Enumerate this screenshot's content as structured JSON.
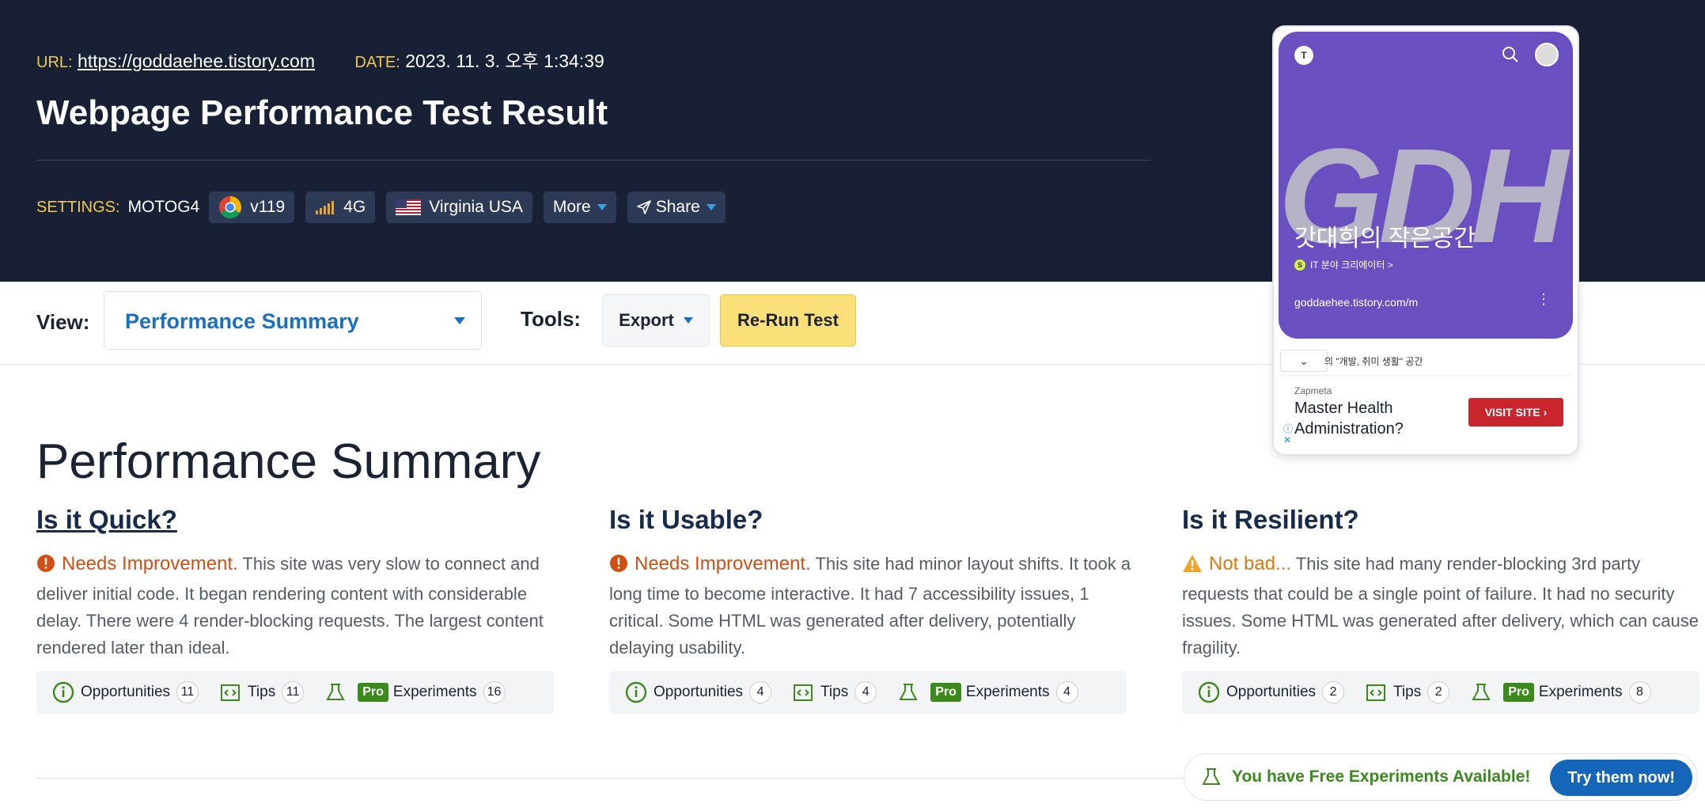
{
  "header": {
    "url_label": "URL:",
    "url": "https://goddaehee.tistory.com",
    "date_label": "DATE:",
    "date": "2023. 11. 3. 오후 1:34:39",
    "title": "Webpage Performance Test Result",
    "settings_label": "SETTINGS:",
    "device": "MOTOG4",
    "browser": "v119",
    "network": "4G",
    "location": "Virginia USA",
    "more": "More",
    "share": "Share"
  },
  "toolbar": {
    "view_label": "View:",
    "view_value": "Performance Summary",
    "tools_label": "Tools:",
    "export": "Export",
    "rerun": "Re-Run Test"
  },
  "summary": {
    "title": "Performance Summary",
    "columns": [
      {
        "heading": "Is it Quick?",
        "status": "Needs Improvement.",
        "text": "This site was very slow to connect and deliver initial code. It began rendering content with considerable delay. There were 4 render-blocking requests. The largest content rendered later than ideal.",
        "opportunities": "11",
        "tips": "11",
        "experiments": "16"
      },
      {
        "heading": "Is it Usable?",
        "status": "Needs Improvement.",
        "text": "This site had minor layout shifts. It took a long time to become interactive. It had 7 accessibility issues, 1 critical. Some HTML was generated after delivery, potentially delaying usability.",
        "opportunities": "4",
        "tips": "4",
        "experiments": "4"
      },
      {
        "heading": "Is it Resilient?",
        "status": "Not bad...",
        "text": "This site had many render-blocking 3rd party requests that could be a single point of failure. It had no security issues. Some HTML was generated after delivery, which can cause fragility.",
        "opportunities": "2",
        "tips": "2",
        "experiments": "8"
      }
    ],
    "labels": {
      "opportunities": "Opportunities",
      "tips": "Tips",
      "pro": "Pro",
      "experiments": "Experiments"
    }
  },
  "preview": {
    "logo": "T",
    "big": "GDH",
    "blog_name": "갓대희의 작은공간",
    "creator": "IT 분야 크리에이터 >",
    "creator_dot": "S",
    "url": "goddaehee.tistory.com/m",
    "strip": "의 \"개발, 취미 생활\" 공간",
    "ad_brand": "Zapmeta",
    "ad_headline_1": "Master Health",
    "ad_headline_2": "Administration?",
    "ad_button": "VISIT SITE"
  },
  "promo": {
    "text": "You have Free Experiments Available!",
    "button": "Try them now!"
  },
  "colors": {
    "header_bg": "#172034",
    "accent_yellow": "#f2c94c",
    "link_blue": "#1a6fc2",
    "needs_improvement": "#d24f14",
    "not_bad": "#d97a0a",
    "pro_green": "#3d8a1c"
  }
}
